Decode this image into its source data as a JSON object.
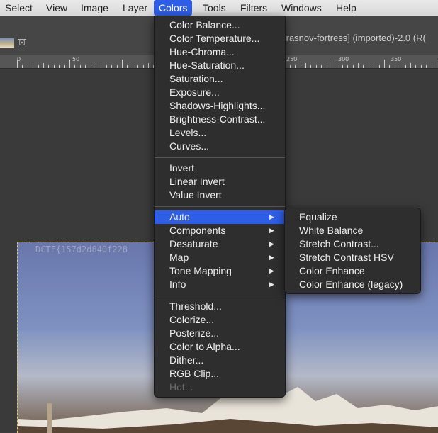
{
  "menubar": {
    "items": [
      "Select",
      "View",
      "Image",
      "Layer",
      "Colors",
      "Tools",
      "Filters",
      "Windows",
      "Help"
    ],
    "active": "Colors"
  },
  "window": {
    "title_fragment": "[rasnov-fortress] (imported)-2.0 (R("
  },
  "tab": {
    "close_glyph": "☒"
  },
  "ruler": {
    "labels": [
      "0",
      "50",
      "250",
      "300",
      "350"
    ]
  },
  "canvas": {
    "watermark_text": "DCTF{157d2d840f228"
  },
  "colors_menu": {
    "group1": [
      "Color Balance...",
      "Color Temperature...",
      "Hue-Chroma...",
      "Hue-Saturation...",
      "Saturation...",
      "Exposure...",
      "Shadows-Highlights...",
      "Brightness-Contrast...",
      "Levels...",
      "Curves..."
    ],
    "group2": [
      "Invert",
      "Linear Invert",
      "Value Invert"
    ],
    "group3": [
      "Auto",
      "Components",
      "Desaturate",
      "Map",
      "Tone Mapping",
      "Info"
    ],
    "group4": [
      "Threshold...",
      "Colorize...",
      "Posterize...",
      "Color to Alpha...",
      "Dither...",
      "RGB Clip...",
      "Hot..."
    ],
    "submenu_arrow": "▶",
    "highlighted": "Auto",
    "disabled": "Hot..."
  },
  "auto_submenu": {
    "items": [
      "Equalize",
      "White Balance",
      "Stretch Contrast...",
      "Stretch Contrast HSV",
      "Color Enhance",
      "Color Enhance (legacy)"
    ]
  },
  "colors": {
    "accent": "#2e5ee8",
    "menu_bg": "#2e2e2e",
    "canvas_bg": "#3a3a3a"
  }
}
